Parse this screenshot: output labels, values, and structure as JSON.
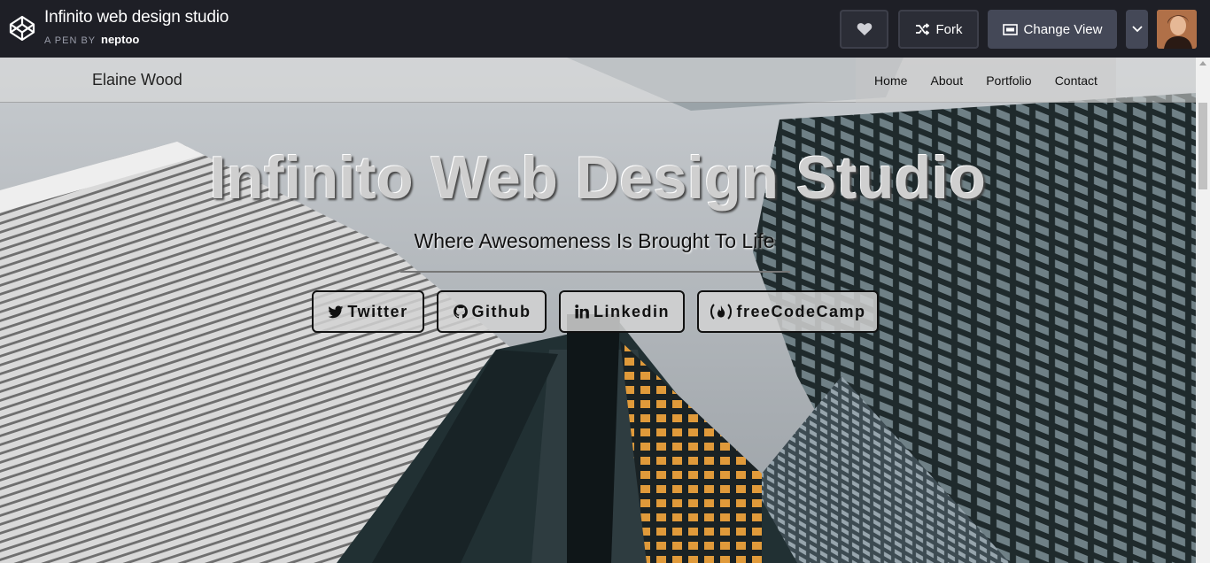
{
  "codepen": {
    "title": "Infinito web design studio",
    "byline_prefix": "A PEN BY",
    "author": "neptoo",
    "buttons": {
      "fork": "Fork",
      "change_view": "Change View"
    }
  },
  "site": {
    "brand": "Elaine Wood",
    "nav": [
      "Home",
      "About",
      "Portfolio",
      "Contact"
    ],
    "hero": {
      "title": "Infinito Web Design Studio",
      "subtitle": "Where Awesomeness Is Brought To Life"
    },
    "social": {
      "twitter": "Twitter",
      "github": "Github",
      "linkedin": "Linkedin",
      "freecodecamp": "freeCodeCamp"
    }
  },
  "colors": {
    "codepen_bar": "#1e1f26",
    "button_dark": "#2b2d36",
    "button_mid": "#444857"
  }
}
